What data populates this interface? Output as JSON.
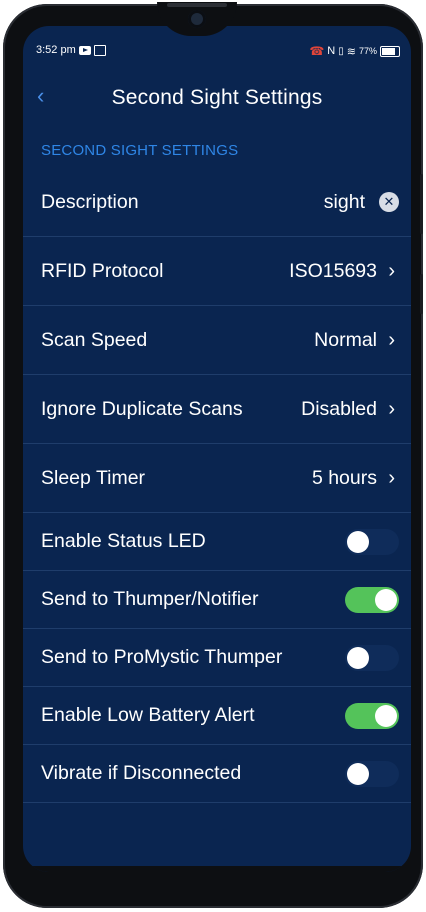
{
  "status": {
    "time": "3:52 pm",
    "battery": "77%"
  },
  "header": {
    "title": "Second Sight Settings"
  },
  "section": {
    "label": "SECOND SIGHT SETTINGS"
  },
  "settings": [
    {
      "label": "Description",
      "value": "sight"
    },
    {
      "label": "RFID Protocol",
      "value": "ISO15693"
    },
    {
      "label": "Scan Speed",
      "value": "Normal"
    },
    {
      "label": "Ignore Duplicate Scans",
      "value": "Disabled"
    },
    {
      "label": "Sleep Timer",
      "value": "5 hours"
    }
  ],
  "toggles": [
    {
      "label": "Enable Status LED",
      "on": false
    },
    {
      "label": "Send to Thumper/Notifier",
      "on": true
    },
    {
      "label": "Send to ProMystic Thumper",
      "on": false
    },
    {
      "label": "Enable Low Battery Alert",
      "on": true
    },
    {
      "label": "Vibrate if Disconnected",
      "on": false
    }
  ],
  "colors": {
    "background": "#0a2550",
    "accent": "#2f86e6",
    "toggle_on": "#54c35a"
  }
}
